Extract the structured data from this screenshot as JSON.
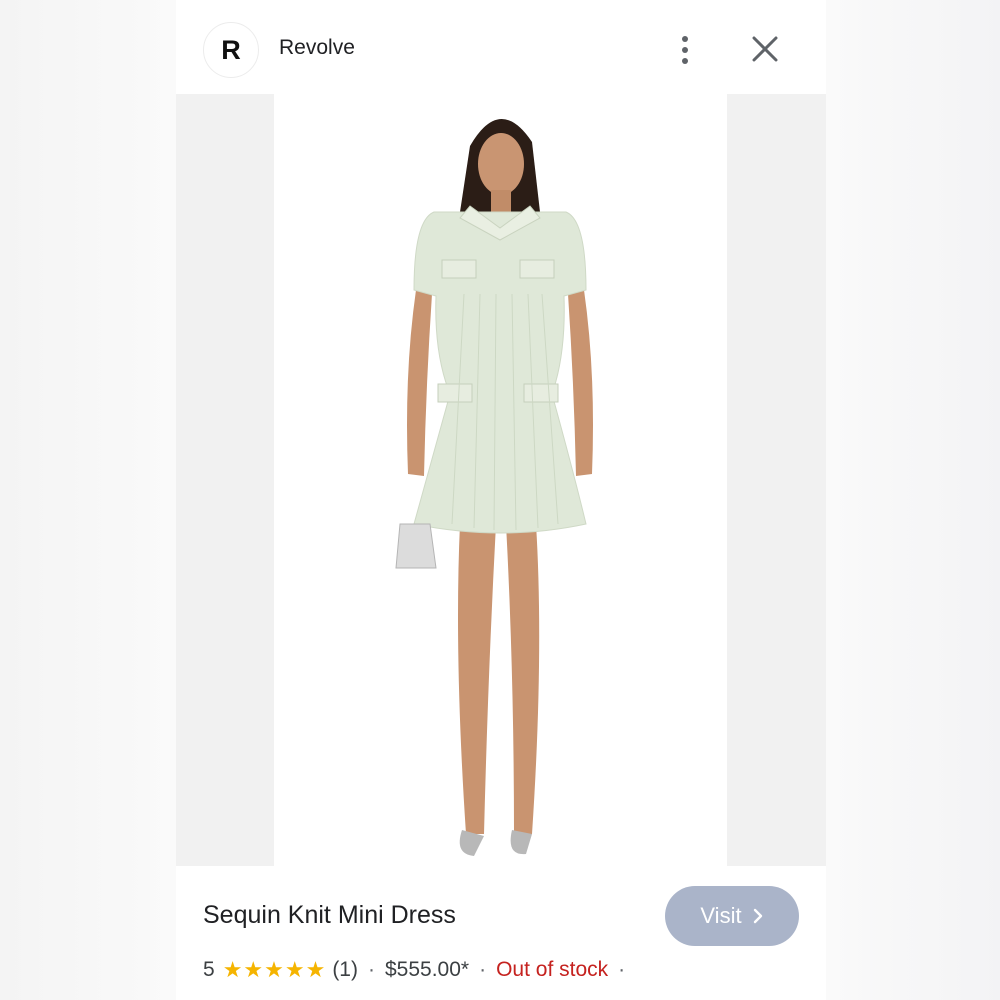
{
  "header": {
    "logo_letter": "R",
    "brand": "Revolve"
  },
  "product": {
    "title": "Sequin Knit Mini Dress",
    "rating_value": "5",
    "stars": "★★★★★",
    "rating_count": "(1)",
    "separator": "·",
    "price": "$555.00*",
    "stock_status": "Out of stock",
    "visit_label": "Visit"
  },
  "colors": {
    "visit_button": "#aab4c9",
    "star": "#f5b400",
    "out_of_stock": "#c5221f",
    "dress": "#dfe8d8"
  },
  "icons": {
    "more": "more-vert-icon",
    "close": "close-icon",
    "visit_arrow": "chevron-right-icon"
  }
}
